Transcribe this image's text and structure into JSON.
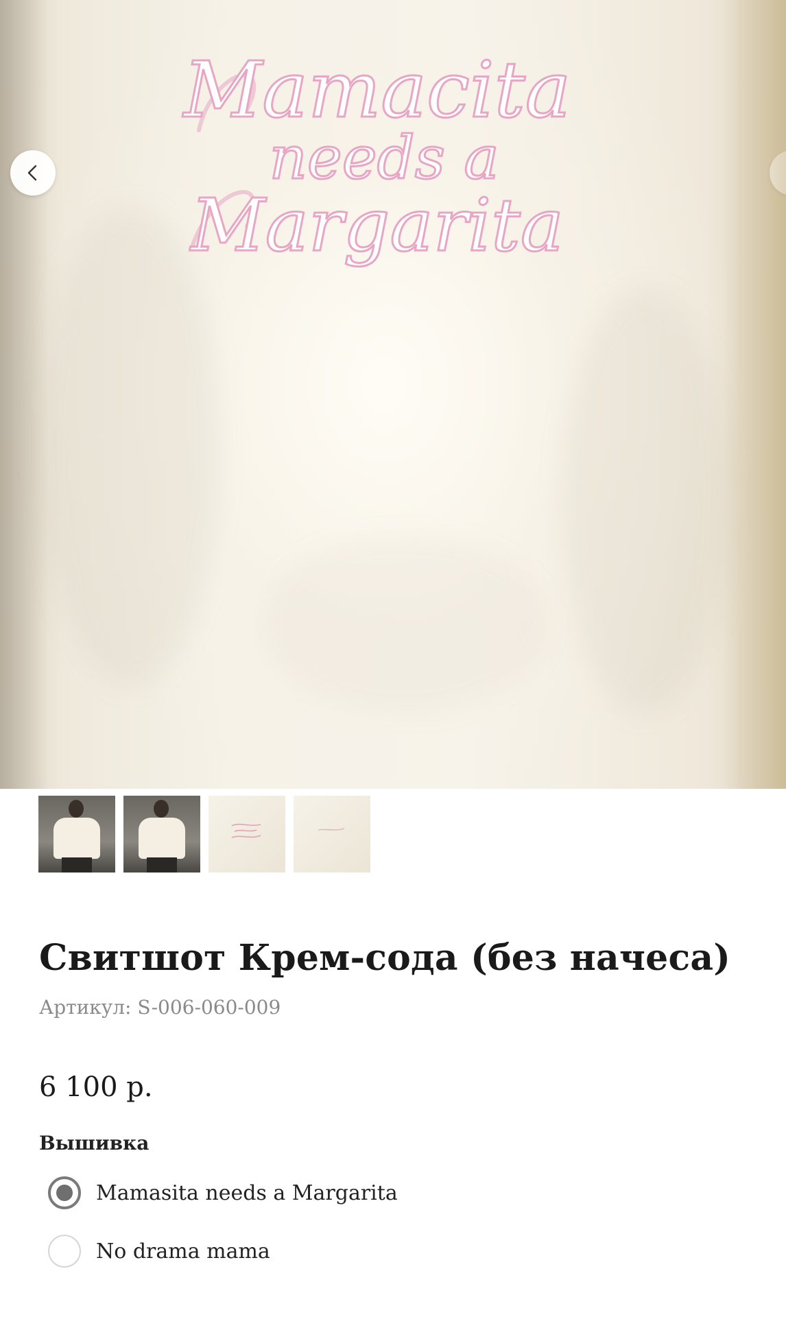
{
  "product": {
    "title": "Свитшот Крем-сода (без начеса)",
    "sku": "Артикул: S-006-060-009",
    "price": "6 100 р."
  },
  "gallery": {
    "embroidery_text": [
      "Mamacita",
      "needs a",
      "Margarita"
    ],
    "thumbnail_count": 4,
    "prev_icon": "chevron-left-icon",
    "next_icon": "chevron-right-icon"
  },
  "options": {
    "label": "Вышивка",
    "choices": [
      {
        "label": "Mamasita needs a Margarita",
        "selected": true
      },
      {
        "label": "No drama mama",
        "selected": false
      }
    ]
  },
  "colors": {
    "embroidery_pink": "#e7a6c4",
    "fabric_cream": "#f6f2e8",
    "radio_selected": "#6f6f6f"
  }
}
